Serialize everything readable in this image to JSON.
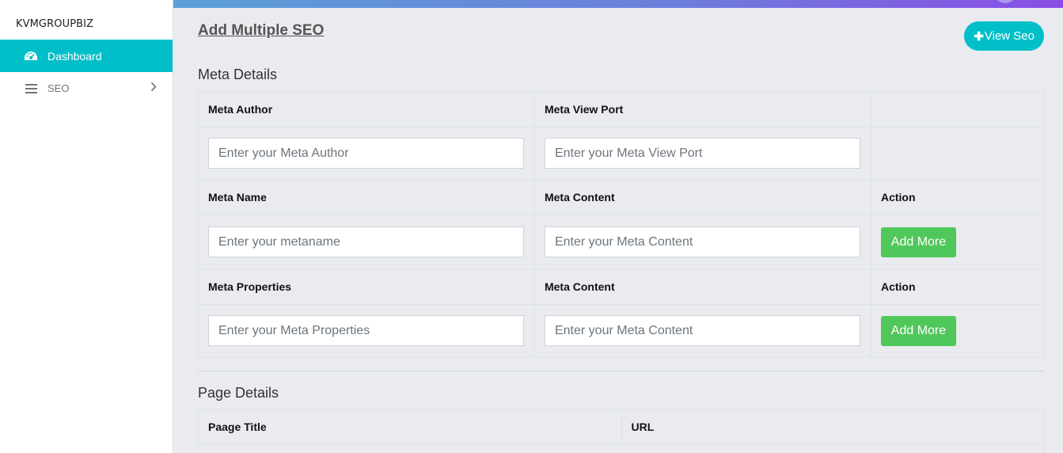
{
  "sidebar": {
    "brand": "KVMGROUPBIZ",
    "items": [
      {
        "label": "Dashboard",
        "icon": "dashboard-icon"
      },
      {
        "label": "SEO",
        "icon": "menu-icon"
      }
    ]
  },
  "header": {
    "title": "Add Multiple SEO",
    "view_button_plus": "✚",
    "view_button_label": "View Seo"
  },
  "meta_details": {
    "title": "Meta Details",
    "row1": {
      "col1_label": "Meta Author",
      "col2_label": "Meta View Port",
      "col1_placeholder": "Enter your Meta Author",
      "col2_placeholder": "Enter your Meta View Port"
    },
    "row2": {
      "col1_label": "Meta Name",
      "col2_label": "Meta Content",
      "col3_label": "Action",
      "col1_placeholder": "Enter your metaname",
      "col2_placeholder": "Enter your Meta Content",
      "button": "Add More"
    },
    "row3": {
      "col1_label": "Meta Properties",
      "col2_label": "Meta Content",
      "col3_label": "Action",
      "col1_placeholder": "Enter your Meta Properties",
      "col2_placeholder": "Enter your Meta Content",
      "button": "Add More"
    }
  },
  "page_details": {
    "title": "Page Details",
    "col1_label": "Paage Title",
    "col2_label": "URL"
  },
  "colors": {
    "accent": "#00bfc9",
    "success": "#50c75a",
    "gradient_start": "#5aa0d8",
    "gradient_end": "#8a4ee6"
  }
}
